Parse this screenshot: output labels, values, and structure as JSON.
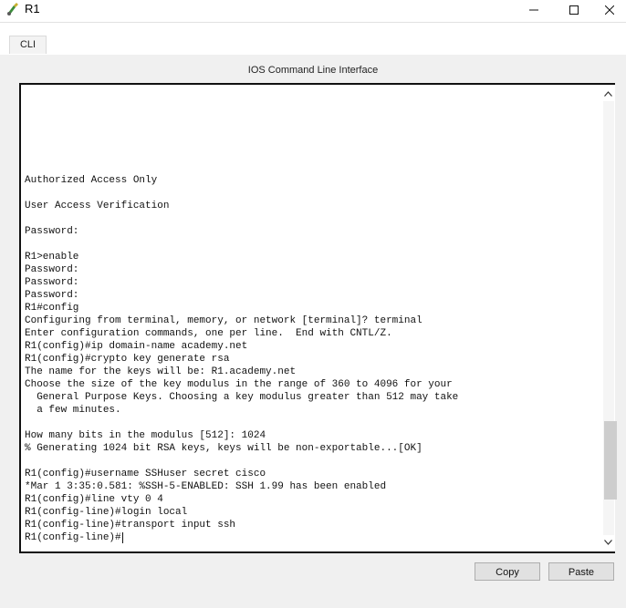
{
  "window": {
    "title": "R1",
    "icon": "router-app-icon",
    "controls": [
      "minimize-icon",
      "maximize-icon",
      "close-icon"
    ]
  },
  "tabs": [
    {
      "label": "CLI",
      "selected": true
    }
  ],
  "panel": {
    "title": "IOS Command Line Interface"
  },
  "terminal": {
    "lines": [
      "Authorized Access Only",
      "",
      "User Access Verification",
      "",
      "Password:",
      "",
      "R1>enable",
      "Password:",
      "Password:",
      "Password:",
      "R1#config",
      "Configuring from terminal, memory, or network [terminal]? terminal",
      "Enter configuration commands, one per line.  End with CNTL/Z.",
      "R1(config)#ip domain-name academy.net",
      "R1(config)#crypto key generate rsa",
      "The name for the keys will be: R1.academy.net",
      "Choose the size of the key modulus in the range of 360 to 4096 for your",
      "  General Purpose Keys. Choosing a key modulus greater than 512 may take",
      "  a few minutes.",
      "",
      "How many bits in the modulus [512]: 1024",
      "% Generating 1024 bit RSA keys, keys will be non-exportable...[OK]",
      "",
      "R1(config)#username SSHuser secret cisco",
      "*Mar 1 3:35:0.581: %SSH-5-ENABLED: SSH 1.99 has been enabled",
      "R1(config)#line vty 0 4",
      "R1(config-line)#login local",
      "R1(config-line)#transport input ssh",
      "R1(config-line)#"
    ],
    "scroll_position": 0.9,
    "scroll_visible_fraction": 0.18
  },
  "buttons": {
    "copy_label": "Copy",
    "paste_label": "Paste"
  }
}
